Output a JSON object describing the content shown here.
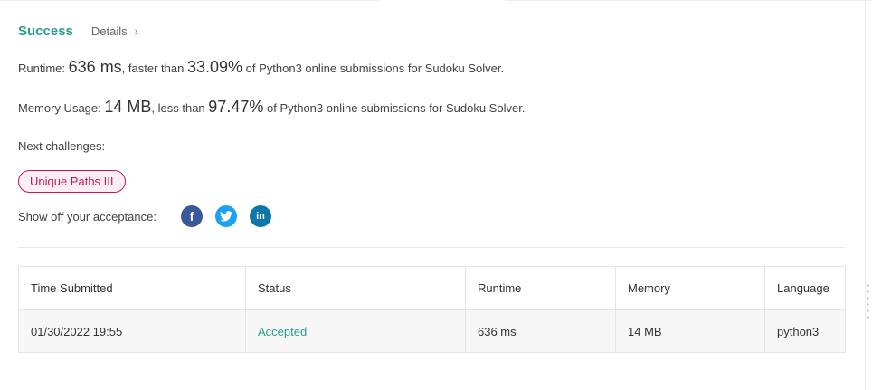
{
  "result": {
    "status": "Success",
    "details_label": "Details",
    "details_chevron": "›"
  },
  "runtime": {
    "label": "Runtime:",
    "value": "636 ms",
    "comparison_prefix": ", faster than",
    "percent": "33.09%",
    "suffix": "of Python3 online submissions for Sudoku Solver."
  },
  "memory": {
    "label": "Memory Usage:",
    "value": "14 MB",
    "comparison_prefix": ", less than",
    "percent": "97.47%",
    "suffix": "of Python3 online submissions for Sudoku Solver."
  },
  "next": {
    "label": "Next challenges:",
    "challenges": [
      "Unique Paths III"
    ]
  },
  "share": {
    "label": "Show off your acceptance:",
    "icons": [
      {
        "name": "facebook-icon",
        "glyph": "f",
        "color": "#3b5998"
      },
      {
        "name": "twitter-icon",
        "color": "#1da1f2"
      },
      {
        "name": "linkedin-icon",
        "glyph": "in",
        "color": "#0e76a8"
      }
    ]
  },
  "table": {
    "columns": [
      "Time Submitted",
      "Status",
      "Runtime",
      "Memory",
      "Language"
    ],
    "rows": [
      [
        "01/30/2022 19:55",
        "Accepted",
        "636 ms",
        "14 MB",
        "python3"
      ]
    ]
  },
  "colors": {
    "success": "#2a9d8f",
    "challenge_border": "#c2185b",
    "challenge_bg": "#fdeef3"
  }
}
